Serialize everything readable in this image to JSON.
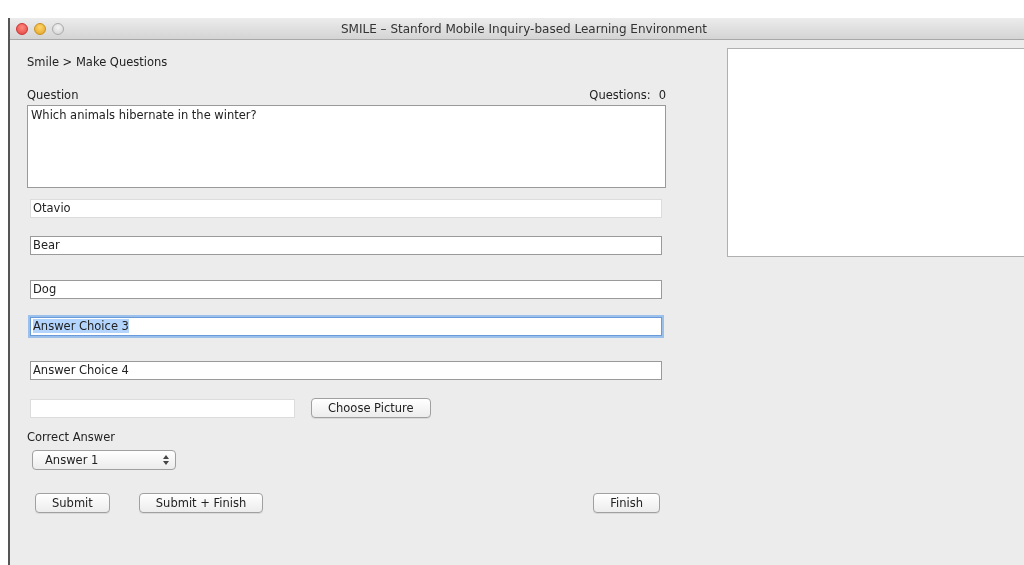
{
  "window": {
    "title": "SMILE – Stanford Mobile Inquiry-based Learning Environment"
  },
  "breadcrumb": "Smile > Make Questions",
  "question": {
    "label": "Question",
    "count_label": "Questions:",
    "count": "0",
    "value": "Which animals hibernate in the winter?"
  },
  "fields": [
    {
      "value": "Otavio",
      "editable": false,
      "focused": false
    },
    {
      "value": "Bear",
      "editable": true,
      "focused": false
    },
    {
      "value": "Dog",
      "editable": true,
      "focused": false
    },
    {
      "value": "Answer Choice 3",
      "editable": true,
      "focused": true
    },
    {
      "value": "Answer Choice 4",
      "editable": true,
      "focused": false
    }
  ],
  "picture": {
    "editable": false,
    "button": "Choose Picture"
  },
  "correct_answer": {
    "label": "Correct Answer",
    "value": "Answer 1"
  },
  "buttons": [
    "Submit",
    "Submit + Finish"
  ],
  "finish_button": "Finish"
}
